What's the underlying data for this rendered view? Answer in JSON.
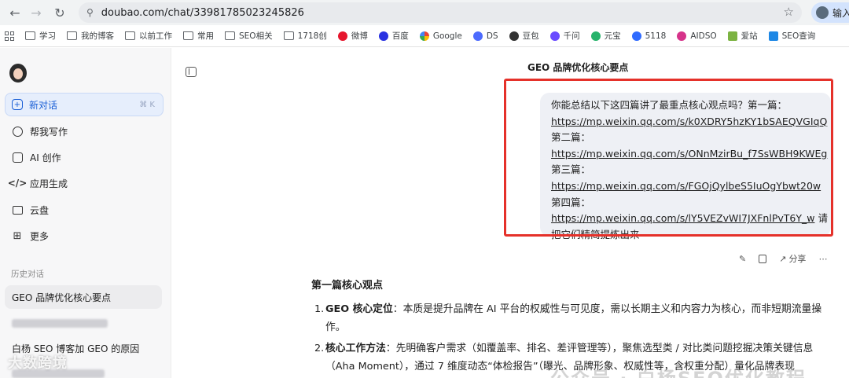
{
  "browser": {
    "url": "doubao.com/chat/33981785023245826",
    "profile_label": "输入"
  },
  "bookmarks": [
    {
      "label": "学习",
      "icon": "folder-icon"
    },
    {
      "label": "我的博客",
      "icon": "folder-icon"
    },
    {
      "label": "以前工作",
      "icon": "folder-icon"
    },
    {
      "label": "常用",
      "icon": "folder-icon"
    },
    {
      "label": "SEO相关",
      "icon": "folder-icon"
    },
    {
      "label": "1718创",
      "icon": "folder-icon"
    },
    {
      "label": "微博",
      "icon": "weibo-icon",
      "color": "#e6162d"
    },
    {
      "label": "百度",
      "icon": "baidu-icon",
      "color": "#2932e1"
    },
    {
      "label": "Google",
      "icon": "google-icon",
      "color": "#4285f4"
    },
    {
      "label": "DS",
      "icon": "deepseek-icon",
      "color": "#4d6bfe"
    },
    {
      "label": "豆包",
      "icon": "doubao-icon",
      "color": "#333333"
    },
    {
      "label": "千问",
      "icon": "qianwen-icon",
      "color": "#6a4bff"
    },
    {
      "label": "元宝",
      "icon": "yuanbao-icon",
      "color": "#27b36b"
    },
    {
      "label": "5118",
      "icon": "5118-icon",
      "color": "#2f6bff"
    },
    {
      "label": "AIDSO",
      "icon": "aidso-icon",
      "color": "#d6338a"
    },
    {
      "label": "爱站",
      "icon": "aizhan-icon",
      "color": "#7cb342"
    },
    {
      "label": "SEO查询",
      "icon": "seo-query-icon",
      "color": "#1e88e5"
    }
  ],
  "sidebar": {
    "new_chat": {
      "label": "新对话",
      "shortcut": "⌘ K"
    },
    "nav": [
      {
        "label": "帮我写作",
        "icon": "writing-icon"
      },
      {
        "label": "AI 创作",
        "icon": "image-icon"
      },
      {
        "label": "应用生成",
        "icon": "code-icon"
      },
      {
        "label": "云盘",
        "icon": "cloud-drive-icon"
      },
      {
        "label": "更多",
        "icon": "grid-icon"
      }
    ],
    "history_title": "历史对话",
    "history": [
      {
        "label": "GEO 品牌优化核心要点",
        "active": true
      },
      {
        "label": "白杨 SEO 博客加 GEO 的原因",
        "active": false
      }
    ]
  },
  "chat": {
    "title": "GEO 品牌优化核心要点",
    "user_message_lines": [
      {
        "text": "你能总结以下这四篇讲了最重点核心观点吗？第一篇：",
        "link": false
      },
      {
        "text": "https://mp.weixin.qq.com/s/k0XDRY5hzKY1bSAEQVGIqQ",
        "link": true
      },
      {
        "text": "第二篇：",
        "link": false
      },
      {
        "text": "https://mp.weixin.qq.com/s/ONnMzirBu_f7SsWBH9KWEg",
        "link": true
      },
      {
        "text": "第三篇：",
        "link": false
      },
      {
        "text": "https://mp.weixin.qq.com/s/FGOjQylbeS5IuOgYbwt20w",
        "link": true
      },
      {
        "text": "第四篇：",
        "link": false
      },
      {
        "text": "https://mp.weixin.qq.com/s/lY5VEZvWI7JXFnlPvT6Y_w",
        "link": true,
        "suffix": "请"
      },
      {
        "text": "把它们精简提炼出来",
        "link": false
      }
    ],
    "actions": {
      "share_label": "分享"
    },
    "answer": {
      "heading": "第一篇核心观点",
      "items": [
        {
          "num": "1.",
          "bold": "GEO 核心定位",
          "text": "：本质是提升品牌在 AI 平台的权威性与可见度，需以长期主义和内容力为核心，而非短期流量操作。"
        },
        {
          "num": "2.",
          "bold": "核心工作方法",
          "text": "：先明确客户需求（如覆盖率、排名、差评管理等），聚焦选型类 / 对比类问题挖掘决策关键信息（Aha Moment），通过 7 维度动态“体检报告”（曝光、品牌形象、权威性等，含权重分配）量化品牌表现"
        }
      ]
    }
  },
  "watermark": {
    "left": "大数跨境",
    "right": "公众号 · 白杨SEO优化教程"
  }
}
